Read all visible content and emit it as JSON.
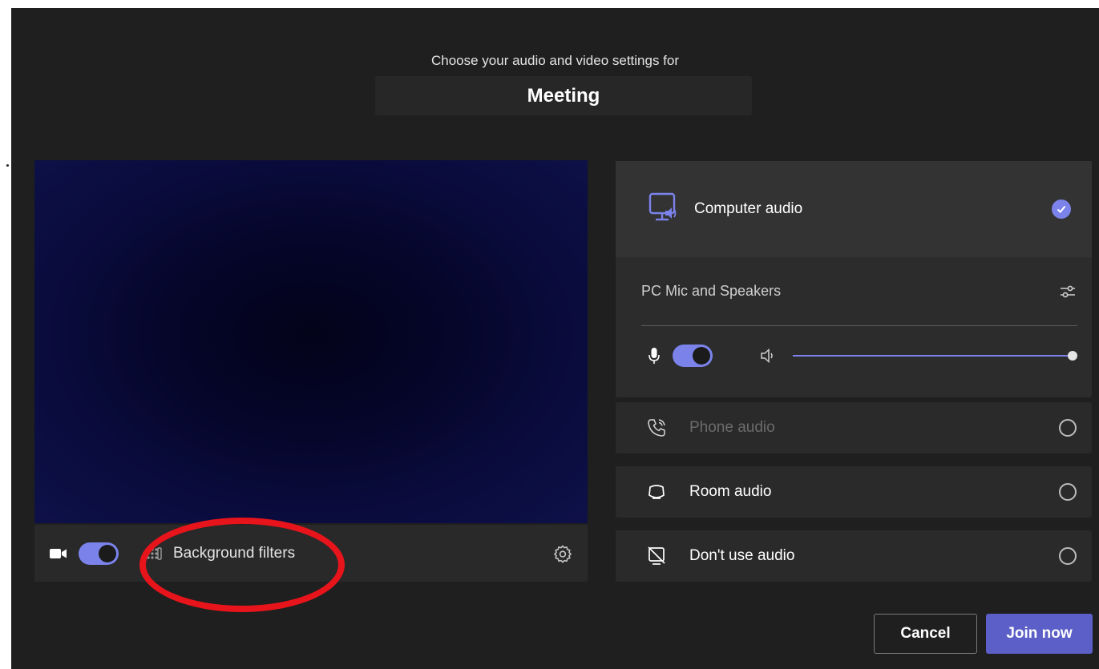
{
  "header": {
    "subtitle": "Choose your audio and video settings for",
    "meeting_title": "Meeting"
  },
  "video": {
    "background_filters_label": "Background filters",
    "camera_on": true
  },
  "audio": {
    "selected": {
      "label": "Computer audio",
      "device": "PC Mic and Speakers",
      "mic_on": true,
      "volume_fraction": 1.0
    },
    "options": [
      {
        "label": "Phone audio",
        "disabled": true
      },
      {
        "label": "Room audio",
        "disabled": false
      },
      {
        "label": "Don't use audio",
        "disabled": false
      }
    ]
  },
  "buttons": {
    "cancel": "Cancel",
    "join": "Join now"
  },
  "colors": {
    "accent": "#7b83eb",
    "primary_button": "#5b5fc7",
    "background": "#1f1f1f",
    "annotation": "#e8141b"
  },
  "icons": [
    "camera-icon",
    "background-filters-icon",
    "gear-icon",
    "computer-audio-icon",
    "checkmark-icon",
    "device-settings-icon",
    "microphone-icon",
    "speaker-icon",
    "phone-audio-icon",
    "room-audio-icon",
    "no-audio-icon"
  ]
}
